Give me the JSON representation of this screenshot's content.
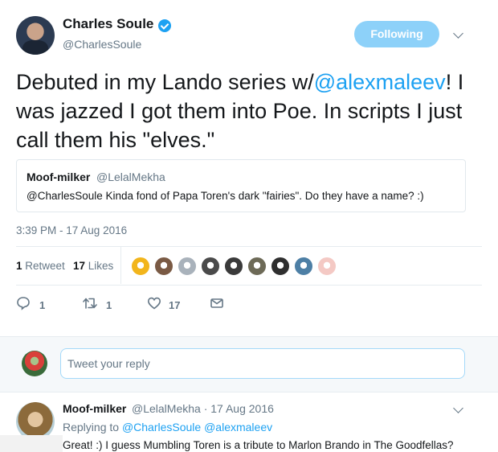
{
  "tweet": {
    "author_name": "Charles Soule",
    "author_handle": "@CharlesSoule",
    "follow_label": "Following",
    "text_before": "Debuted in my Lando series w/",
    "text_mention": "@alexmaleev",
    "text_after": "! I was jazzed I got them into Poe. In scripts I just call them his \"elves.\"",
    "timestamp": "3:39 PM - 17 Aug 2016"
  },
  "quote": {
    "name": "Moof-milker",
    "handle": "@LelalMekha",
    "text": "@CharlesSoule Kinda fond of Papa Toren's dark \"fairies\". Do they have a name? :)"
  },
  "stats": {
    "retweets_count": "1",
    "retweets_label": "Retweet",
    "likes_count": "17",
    "likes_label": "Likes",
    "likers": [
      "#f2b51c",
      "#7a5a44",
      "#a9b2bb",
      "#4a4a4a",
      "#3a3a3a",
      "#6d6a57",
      "#2f2f2f",
      "#4d7fa5",
      "#f4c9c4"
    ]
  },
  "actions": {
    "reply_count": "1",
    "retweet_count": "1",
    "like_count": "17"
  },
  "reply_box": {
    "placeholder": "Tweet your reply"
  },
  "reply": {
    "name": "Moof-milker",
    "meta": "@LelalMekha · 17 Aug 2016",
    "replying_to_label": "Replying to",
    "mention_1": "@CharlesSoule",
    "mention_2": "@alexmaleev",
    "text": "Great! :) I guess Mumbling Toren is a tribute to Marlon Brando in The Goodfellas?"
  },
  "colors": {
    "accent": "#1da1f2",
    "muted": "#657786",
    "like_icon": "#657786"
  }
}
